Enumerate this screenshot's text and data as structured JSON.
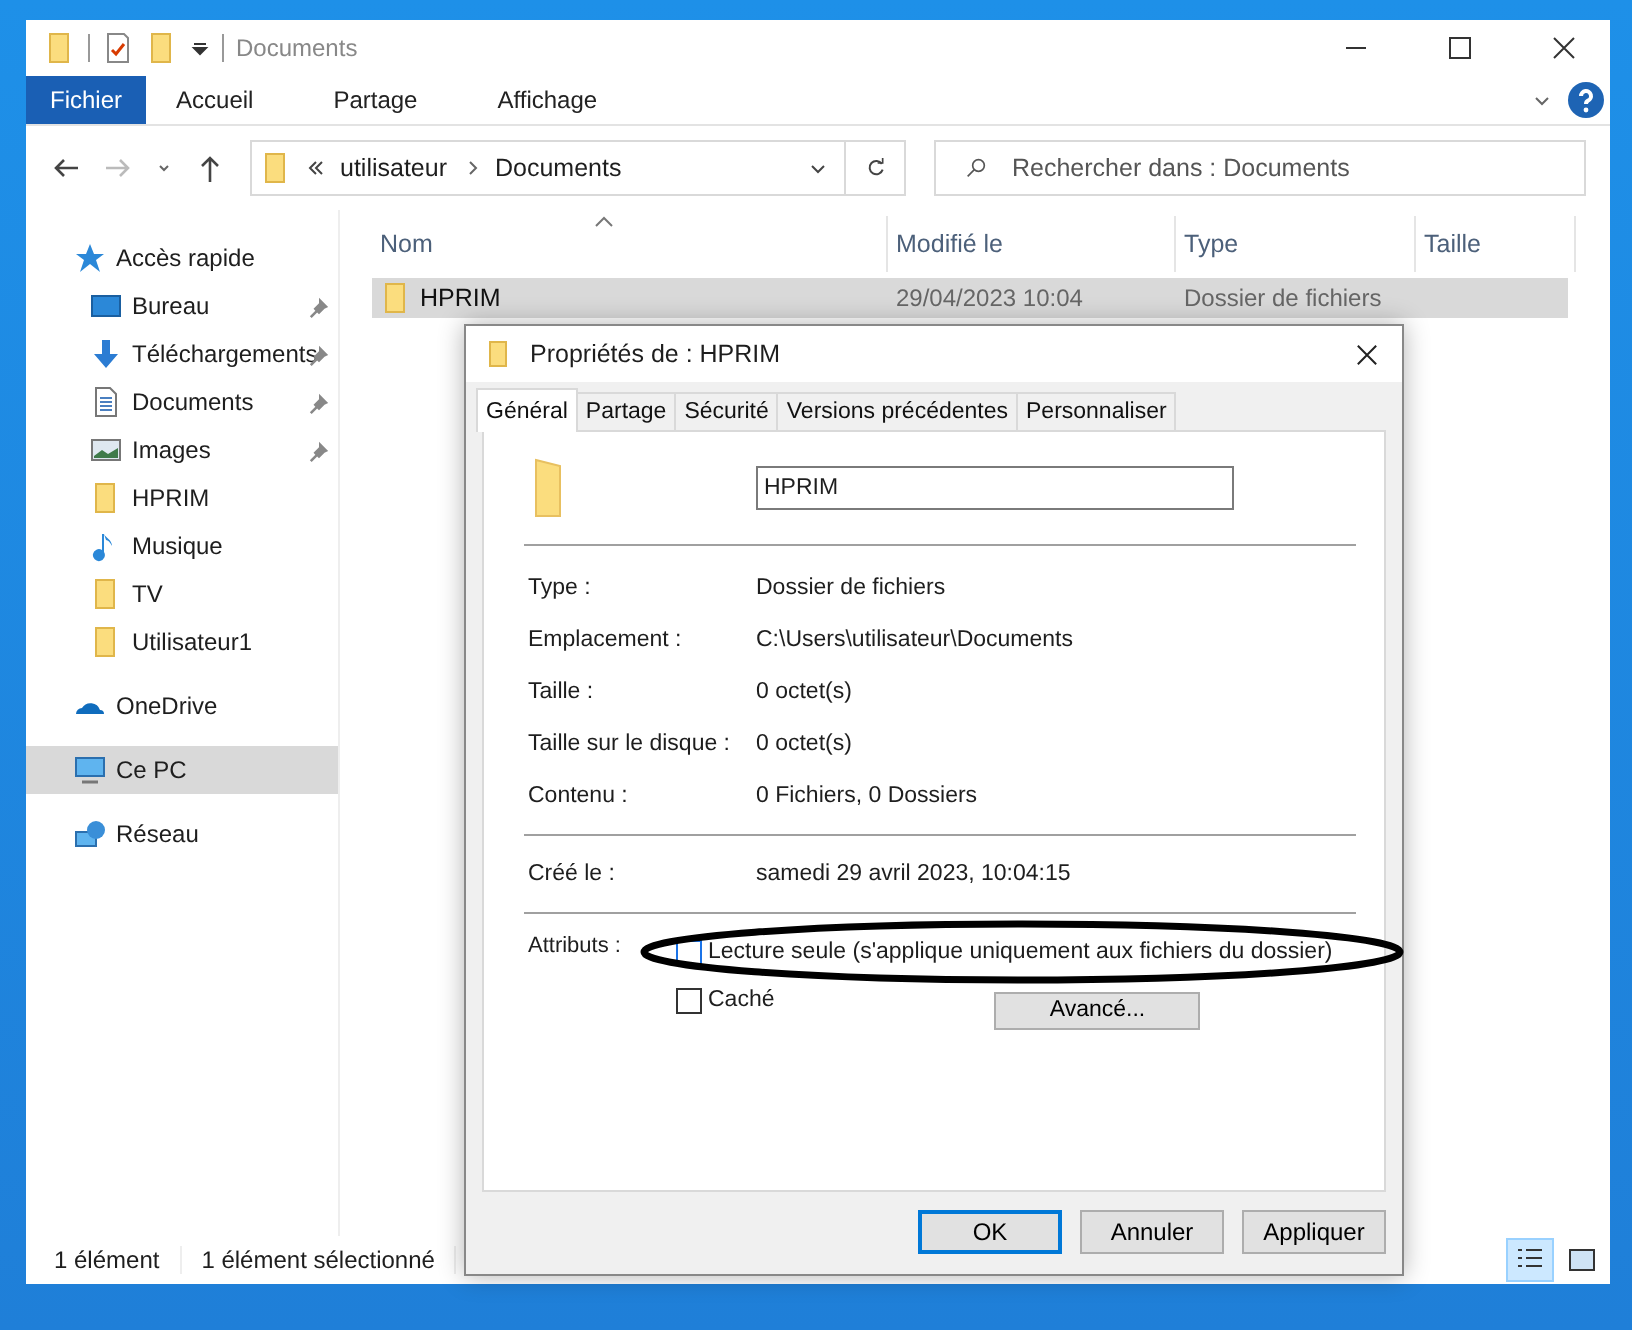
{
  "window": {
    "title": "Documents"
  },
  "ribbon_tabs": [
    {
      "label": "Fichier",
      "selected": true
    },
    {
      "label": "Accueil",
      "selected": false
    },
    {
      "label": "Partage",
      "selected": false
    },
    {
      "label": "Affichage",
      "selected": false
    }
  ],
  "address_bar": {
    "path": [
      "utilisateur",
      "Documents"
    ]
  },
  "search": {
    "placeholder": "Rechercher dans : Documents"
  },
  "sidebar": {
    "items": [
      {
        "label": "Accès rapide",
        "kind": "star",
        "selected": false,
        "children": [
          {
            "label": "Bureau",
            "kind": "desktop",
            "pinned": true,
            "selected": false
          },
          {
            "label": "Téléchargements",
            "kind": "download",
            "pinned": true,
            "selected": false
          },
          {
            "label": "Documents",
            "kind": "document",
            "pinned": true,
            "selected": false
          },
          {
            "label": "Images",
            "kind": "image",
            "pinned": true,
            "selected": false
          },
          {
            "label": "HPRIM",
            "kind": "folder",
            "pinned": false,
            "selected": false
          },
          {
            "label": "Musique",
            "kind": "music",
            "pinned": false,
            "selected": false
          },
          {
            "label": "TV",
            "kind": "folder",
            "pinned": false,
            "selected": false
          },
          {
            "label": "Utilisateur1",
            "kind": "folder",
            "pinned": false,
            "selected": false
          }
        ]
      },
      {
        "label": "OneDrive",
        "kind": "cloud",
        "selected": false
      },
      {
        "label": "Ce PC",
        "kind": "pc",
        "selected": true
      },
      {
        "label": "Réseau",
        "kind": "network",
        "selected": false
      }
    ]
  },
  "table": {
    "columns": [
      "Nom",
      "Modifié le",
      "Type",
      "Taille"
    ],
    "rows": [
      {
        "cells": [
          "HPRIM",
          "29/04/2023 10:04",
          "Dossier de fichiers"
        ],
        "selected": true
      }
    ]
  },
  "status_bar": {
    "items": [
      "1 élément",
      "1 élément sélectionné"
    ],
    "views": [
      {
        "kind": "details",
        "selected": true
      },
      {
        "kind": "tiles",
        "selected": false
      }
    ]
  },
  "dialog": {
    "title": "Propriétés de : HPRIM",
    "tabs": [
      {
        "label": "Général",
        "selected": true
      },
      {
        "label": "Partage",
        "selected": false
      },
      {
        "label": "Sécurité",
        "selected": false
      },
      {
        "label": "Versions précédentes",
        "selected": false
      },
      {
        "label": "Personnaliser",
        "selected": false
      }
    ],
    "name_value": "HPRIM",
    "properties": [
      {
        "label": "Type :",
        "value": "Dossier de fichiers"
      },
      {
        "label": "Emplacement :",
        "value": "C:\\Users\\utilisateur\\Documents"
      },
      {
        "label": "Taille :",
        "value": "0 octet(s)"
      },
      {
        "label": "Taille sur le disque :",
        "value": "0 octet(s)"
      },
      {
        "label": "Contenu :",
        "value": "0 Fichiers, 0 Dossiers"
      }
    ],
    "created": {
      "label": "Créé le :",
      "value": "samedi 29 avril 2023, 10:04:15"
    },
    "attributes_label": "Attributs :",
    "attributes": [
      {
        "label": "Lecture seule (s'applique uniquement aux fichiers du dossier)",
        "checked": false,
        "focused": true
      },
      {
        "label": "Caché",
        "checked": false,
        "focused": false
      }
    ],
    "advanced_button": "Avancé...",
    "buttons": [
      {
        "label": "OK",
        "default": true
      },
      {
        "label": "Annuler",
        "default": false
      },
      {
        "label": "Appliquer",
        "default": false
      }
    ]
  }
}
